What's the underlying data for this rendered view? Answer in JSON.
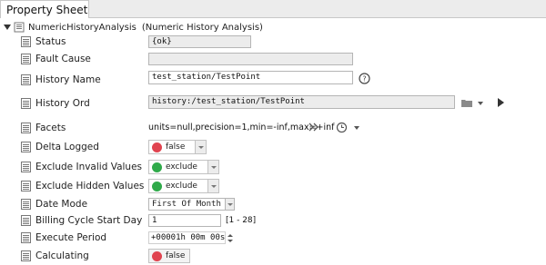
{
  "tab": {
    "label": "Property Sheet"
  },
  "header": {
    "name": "NumericHistoryAnalysis",
    "type_label": "(Numeric History Analysis)"
  },
  "colors": {
    "false_dot": "#e0434f",
    "true_dot": "#2faa4a"
  },
  "properties": {
    "status": {
      "label": "Status",
      "value": "{ok}"
    },
    "fault_cause": {
      "label": "Fault Cause",
      "value": ""
    },
    "history_name": {
      "label": "History Name",
      "value": "test_station/TestPoint",
      "help_icon": "help-icon"
    },
    "history_ord": {
      "label": "History Ord",
      "value": "history:/test_station/TestPoint"
    },
    "facets": {
      "label": "Facets",
      "value": "units=null,precision=1,min=-inf,max=+inf"
    },
    "delta_logged": {
      "label": "Delta Logged",
      "value": "false"
    },
    "exclude_invalid": {
      "label": "Exclude Invalid Values",
      "value": "exclude"
    },
    "exclude_hidden": {
      "label": "Exclude Hidden Values",
      "value": "exclude"
    },
    "date_mode": {
      "label": "Date Mode",
      "value": "First Of Month"
    },
    "billing_cycle": {
      "label": "Billing Cycle Start Day",
      "value": "1",
      "range": "[1 - 28]"
    },
    "execute_period": {
      "label": "Execute Period",
      "value": "+00001h 00m 00s"
    },
    "calculating": {
      "label": "Calculating",
      "value": "false"
    }
  }
}
